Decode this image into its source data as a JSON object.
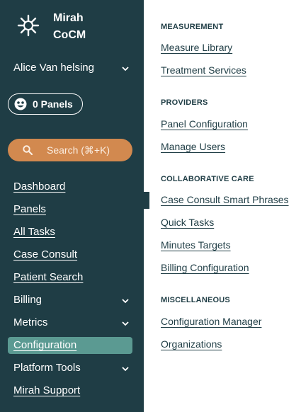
{
  "brand": {
    "line1": "Mirah",
    "line2": "CoCM",
    "logo_icon": "starburst-logo-icon"
  },
  "user": {
    "name": "Alice Van helsing"
  },
  "panels": {
    "label": "0 Panels",
    "icon": "panel-face-icon"
  },
  "search": {
    "label": "Search  (⌘+K)",
    "icon": "search-icon"
  },
  "nav": {
    "items": [
      {
        "label": "Dashboard"
      },
      {
        "label": "Panels"
      },
      {
        "label": "All Tasks"
      },
      {
        "label": "Case Consult"
      },
      {
        "label": "Patient Search"
      },
      {
        "label": "Billing"
      },
      {
        "label": "Metrics"
      },
      {
        "label": "Configuration"
      },
      {
        "label": "Platform Tools"
      },
      {
        "label": "Mirah Support"
      }
    ]
  },
  "sections": [
    {
      "title": "MEASUREMENT",
      "links": [
        "Measure Library",
        "Treatment Services"
      ]
    },
    {
      "title": "PROVIDERS",
      "links": [
        "Panel Configuration",
        "Manage Users"
      ]
    },
    {
      "title": "COLLABORATIVE CARE",
      "links": [
        "Case Consult Smart Phrases",
        "Quick Tasks",
        "Minutes Targets",
        "Billing Configuration"
      ]
    },
    {
      "title": "MISCELLANEOUS",
      "links": [
        "Configuration Manager",
        "Organizations"
      ]
    }
  ],
  "colors": {
    "sidebar": "#1f3d45",
    "active": "#5b9a92",
    "search": "#d2894f",
    "text_dark": "#1f3d45"
  }
}
